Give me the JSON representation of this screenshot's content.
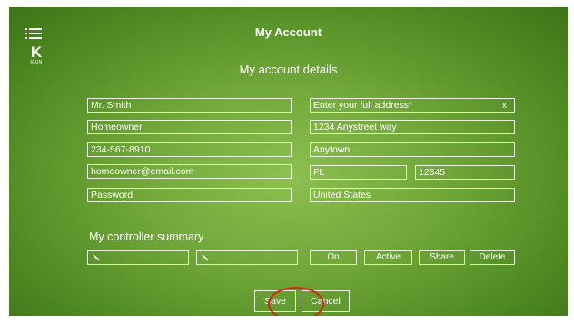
{
  "header": {
    "title": "My Account",
    "brand_letter": "K",
    "brand_sub": "RAIN"
  },
  "details": {
    "heading": "My account details",
    "left": [
      "Mr. Smith",
      "Homeowner",
      "234-567-8910",
      "homeowner@email.com",
      "Password"
    ],
    "address_placeholder": "Enter your full address*",
    "clear_label": "x",
    "street": "1234 Anystreet way",
    "city": "Anytown",
    "state": "FL",
    "zip": "12345",
    "country": "United States"
  },
  "controller": {
    "heading": "My controller summary",
    "on_label": "On",
    "active_label": "Active",
    "share_label": "Share",
    "delete_label": "Delete"
  },
  "actions": {
    "save_label": "Save",
    "cancel_label": "Cancel"
  },
  "colors": {
    "accent_circle": "#d8231a",
    "background": "#72a83a"
  }
}
